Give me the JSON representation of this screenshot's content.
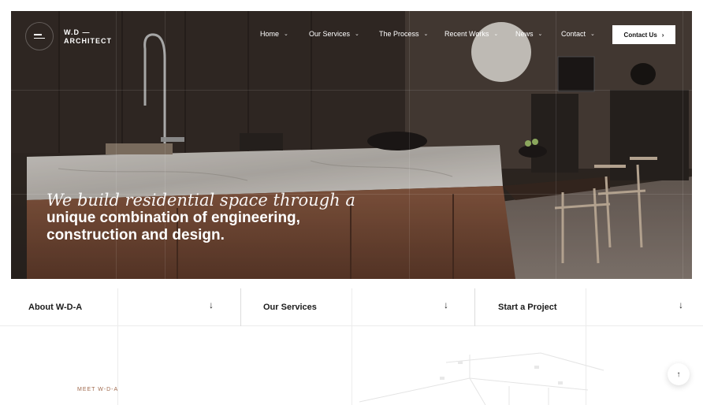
{
  "brand": {
    "line1": "W.D —",
    "line2": "ARCHITECT"
  },
  "nav": {
    "items": [
      {
        "label": "Home",
        "chevron": "⌄"
      },
      {
        "label": "Our Services",
        "chevron": "⌄"
      },
      {
        "label": "The Process",
        "chevron": "⌄"
      },
      {
        "label": "Recent Works",
        "chevron": "⌄"
      },
      {
        "label": "News",
        "chevron": "⌄"
      },
      {
        "label": "Contact",
        "chevron": "⌄"
      }
    ],
    "cta_label": "Contact Us",
    "cta_arrow": "›"
  },
  "hero": {
    "headline_italic": "We build residential space through a",
    "headline_bold_1": "unique combination of engineering,",
    "headline_bold_2": "construction and design."
  },
  "sections": [
    {
      "label": "About W-D-A",
      "arrow": "↓"
    },
    {
      "label": "Our Services",
      "arrow": "↓"
    },
    {
      "label": "Start a Project",
      "arrow": "↓"
    }
  ],
  "meet_label": "MEET W-D-A",
  "back_to_top": "↑",
  "colors": {
    "accent": "#a06a4e",
    "hero_dark": "#2e2622",
    "copper": "#7a4a34"
  }
}
